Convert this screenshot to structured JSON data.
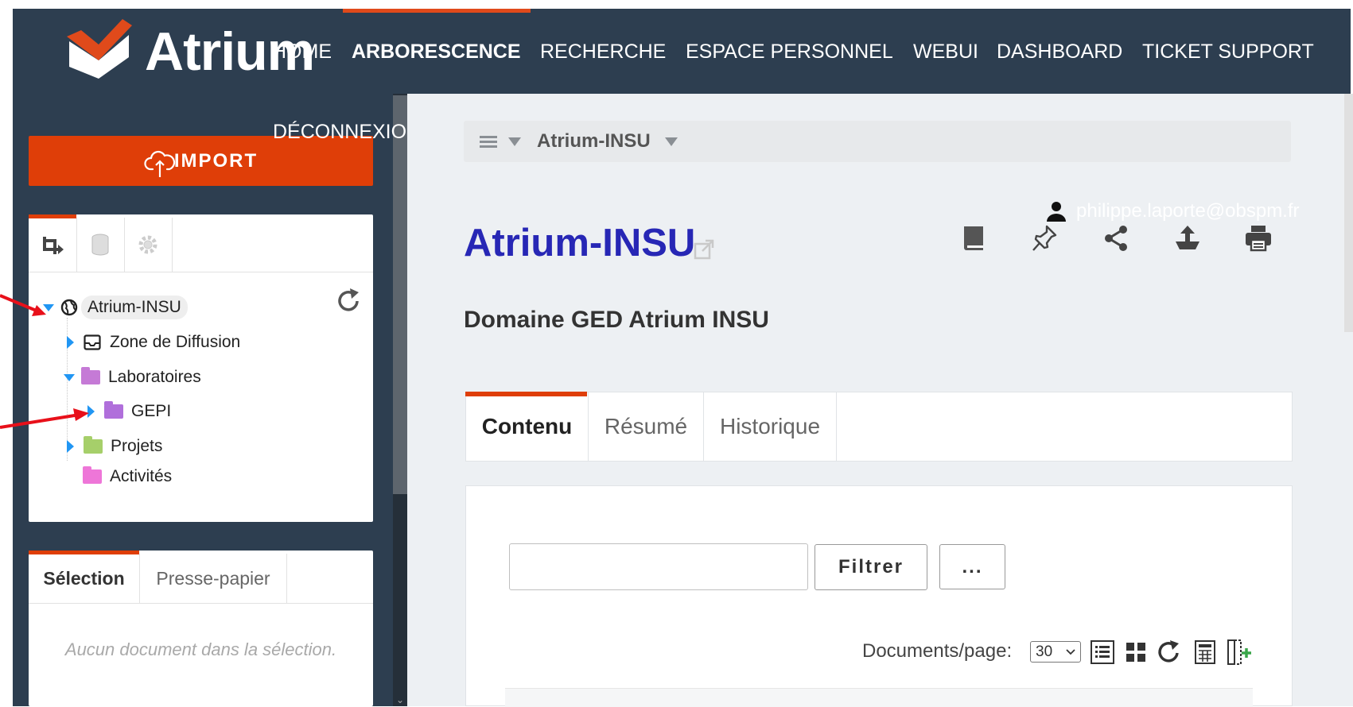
{
  "app": {
    "logo_text": "Atrium"
  },
  "nav": {
    "home": "HOME",
    "arborescence": "ARBORESCENCE",
    "recherche": "RECHERCHE",
    "espace_personnel": "ESPACE PERSONNEL",
    "webui": "WEBUI",
    "dashboard": "DASHBOARD",
    "ticket_support": "TICKET SUPPORT",
    "deconnexion": "DÉCONNEXION",
    "active": "ARBORESCENCE"
  },
  "sidebar": {
    "import_label": "IMPORT",
    "tree_tabs": [
      "tree-icon",
      "database-icon",
      "gear-icon"
    ],
    "tree": [
      {
        "label": "Atrium-INSU",
        "icon": "globe-icon",
        "expanded": true
      },
      {
        "label": "Zone de Diffusion",
        "icon": "inbox-icon",
        "expanded": false
      },
      {
        "label": "Laboratoires",
        "icon": "folder-icon",
        "expanded": true
      },
      {
        "label": "GEPI",
        "icon": "folder-icon",
        "expanded": false
      },
      {
        "label": "Projets",
        "icon": "folder-icon",
        "expanded": false
      },
      {
        "label": "Activités",
        "icon": "folder-icon"
      }
    ],
    "selection_tabs": [
      "Sélection",
      "Presse-papier"
    ],
    "selection_empty": "Aucun document dans la sélection."
  },
  "main": {
    "breadcrumb": "Atrium-INSU",
    "user_email": "philippe.laporte@obspm.fr",
    "title": "Atrium-INSU",
    "subtitle": "Domaine GED Atrium INSU",
    "tabs": [
      "Contenu",
      "Résumé",
      "Historique"
    ],
    "active_tab": "Contenu",
    "filter_placeholder": "",
    "filter_button": "Filtrer",
    "more_button": "...",
    "docs_per_page_label": "Documents/page:",
    "docs_per_page_value": "30"
  },
  "colors": {
    "nav_bg": "#2d3e50",
    "accent": "#df3e08",
    "title_blue": "#2727b5",
    "content_bg": "#edf0f3",
    "annotation_arrow": "#e8101a"
  }
}
